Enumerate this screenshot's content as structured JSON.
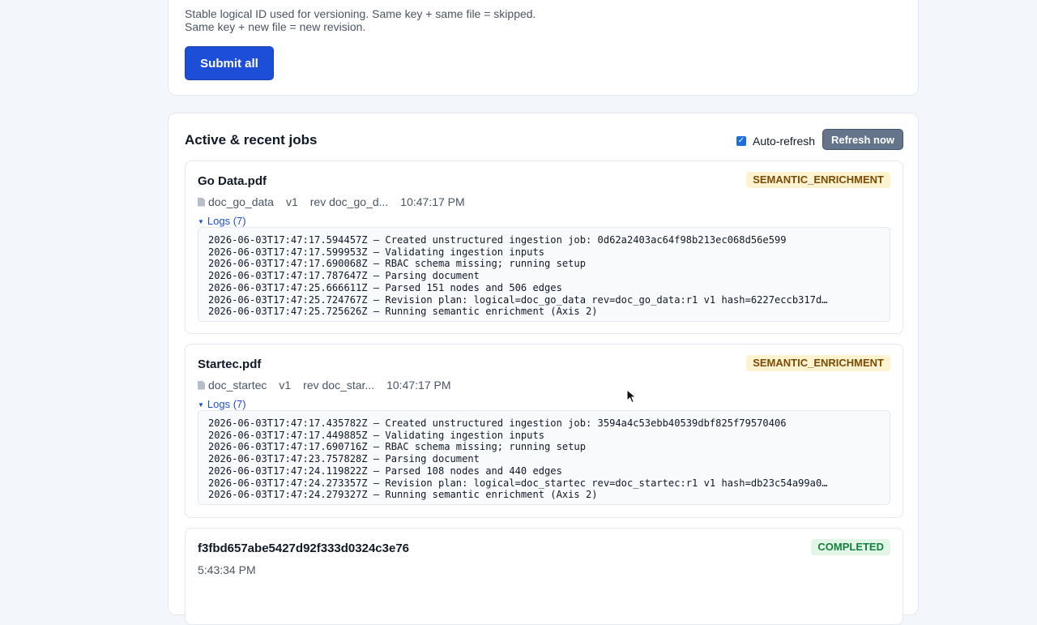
{
  "form": {
    "help_line1": "Stable logical ID used for versioning. Same key + same file = skipped.",
    "help_line2": "Same key + new file = new revision.",
    "submit_label": "Submit all"
  },
  "jobs_section": {
    "title": "Active & recent jobs",
    "auto_refresh_label": "Auto-refresh",
    "auto_refresh_checked": true,
    "refresh_label": "Refresh now"
  },
  "jobs": [
    {
      "title": "Go Data.pdf",
      "status": "SEMANTIC_ENRICHMENT",
      "doc_id": "doc_go_data",
      "version": "v1",
      "rev": "rev doc_go_d...",
      "time": "10:47:17 PM",
      "logs_label": "Logs (7)",
      "logs": [
        "2026-06-03T17:47:17.594457Z – Created unstructured ingestion job: 0d62a2403ac64f98b213ec068d56e599",
        "2026-06-03T17:47:17.599953Z – Validating ingestion inputs",
        "2026-06-03T17:47:17.690068Z – RBAC schema missing; running setup",
        "2026-06-03T17:47:17.787647Z – Parsing document",
        "2026-06-03T17:47:25.666611Z – Parsed 151 nodes and 506 edges",
        "2026-06-03T17:47:25.724767Z – Revision plan: logical=doc_go_data rev=doc_go_data:r1 v1 hash=6227eccb317d…",
        "2026-06-03T17:47:25.725626Z – Running semantic enrichment (Axis 2)"
      ]
    },
    {
      "title": "Startec.pdf",
      "status": "SEMANTIC_ENRICHMENT",
      "doc_id": "doc_startec",
      "version": "v1",
      "rev": "rev doc_star...",
      "time": "10:47:17 PM",
      "logs_label": "Logs (7)",
      "logs": [
        "2026-06-03T17:47:17.435782Z – Created unstructured ingestion job: 3594a4c53ebb40539dbf825f79570406",
        "2026-06-03T17:47:17.449885Z – Validating ingestion inputs",
        "2026-06-03T17:47:17.690716Z – RBAC schema missing; running setup",
        "2026-06-03T17:47:23.757828Z – Parsing document",
        "2026-06-03T17:47:24.119822Z – Parsed 108 nodes and 440 edges",
        "2026-06-03T17:47:24.273357Z – Revision plan: logical=doc_startec rev=doc_startec:r1 v1 hash=db23c54a99a0…",
        "2026-06-03T17:47:24.279327Z – Running semantic enrichment (Axis 2)"
      ]
    },
    {
      "title": "f3fbd657abe5427d92f333d0324c3e76",
      "status": "COMPLETED",
      "time": "5:43:34 PM"
    }
  ],
  "colors": {
    "primary": "#1d4ed8",
    "secondary": "#64748b",
    "badge_warning_bg": "#fdf3d1",
    "badge_success_bg": "#e1f6e6"
  }
}
